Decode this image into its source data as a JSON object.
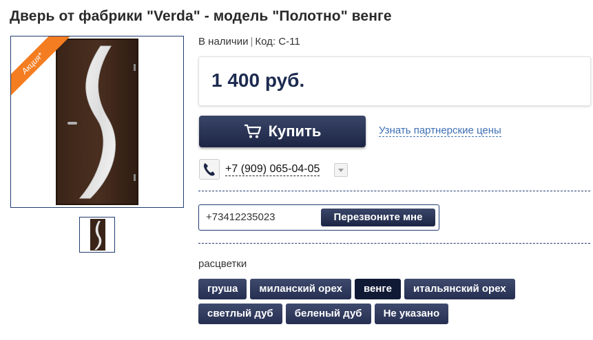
{
  "product": {
    "title": "Дверь от фабрики \"Verda\" - модель \"Полотно\" венге",
    "promo_badge": "Акция*",
    "availability": "В наличии",
    "code_label": "Код: С-11",
    "price": "1 400 руб."
  },
  "actions": {
    "buy_label": "Купить",
    "partner_link": "Узнать партнерские цены"
  },
  "contact": {
    "phone": "+7 (909) 065-04-05",
    "callback_value": "+73412235023",
    "callback_button": "Перезвоните мне"
  },
  "colors": {
    "label": "расцветки",
    "rows": [
      [
        "груша",
        "миланский орех",
        "венге",
        "итальянский орех"
      ],
      [
        "светлый дуб",
        "беленый дуб",
        "Не указано"
      ]
    ],
    "selected": "венге"
  },
  "theme": {
    "accent": "#1c2544",
    "promo": "#f37d20",
    "link": "#3d6fb5"
  }
}
